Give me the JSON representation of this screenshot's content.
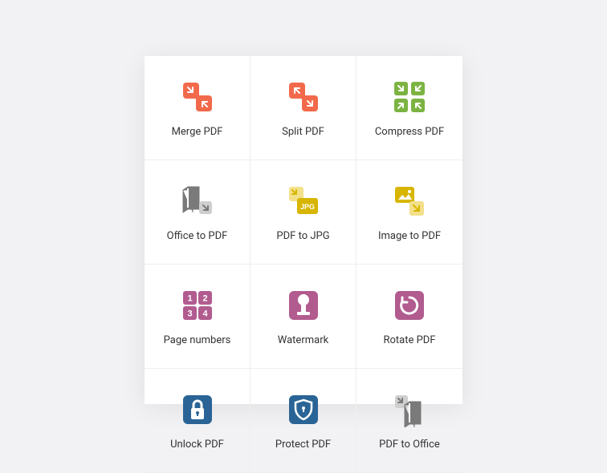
{
  "tools": [
    {
      "label": "Merge PDF"
    },
    {
      "label": "Split PDF"
    },
    {
      "label": "Compress PDF"
    },
    {
      "label": "Office to PDF"
    },
    {
      "label": "PDF to JPG"
    },
    {
      "label": "Image to PDF"
    },
    {
      "label": "Page numbers"
    },
    {
      "label": "Watermark"
    },
    {
      "label": "Rotate PDF"
    },
    {
      "label": "Unlock PDF"
    },
    {
      "label": "Protect PDF"
    },
    {
      "label": "PDF to Office"
    }
  ],
  "colors": {
    "orange": "#f26a4b",
    "green": "#7cb342",
    "yellow": "#d7b500",
    "yellowLight": "#f3e08a",
    "purple": "#b15b8f",
    "blue": "#2a6496",
    "grey": "#7a7a7a",
    "greyLight": "#cfcfcf"
  }
}
